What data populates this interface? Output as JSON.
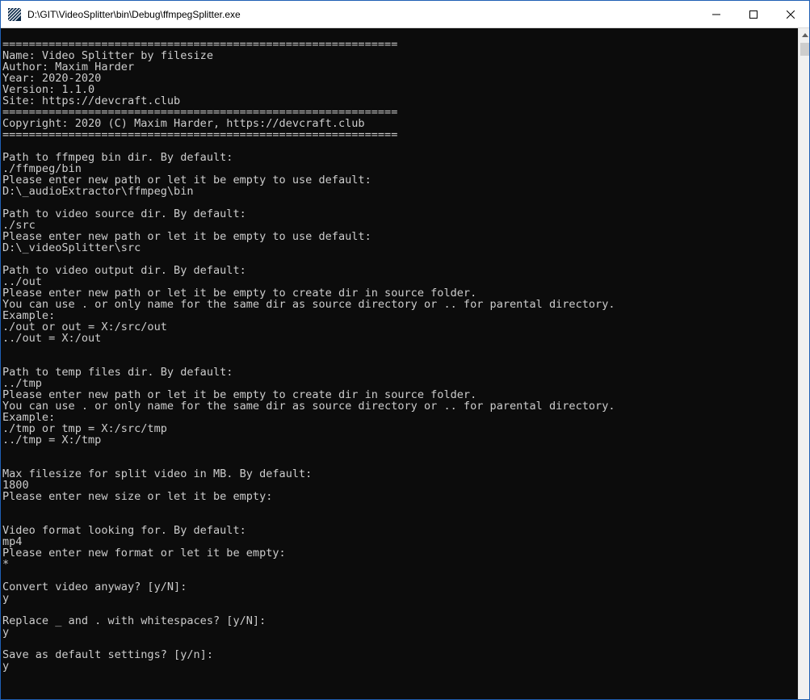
{
  "window": {
    "title": "D:\\GIT\\VideoSplitter\\bin\\Debug\\ffmpegSplitter.exe"
  },
  "controls": {
    "minimize": "minimize-icon",
    "maximize": "maximize-icon",
    "close": "close-icon"
  },
  "console": {
    "lines": [
      "============================================================",
      "Name: Video Splitter by filesize",
      "Author: Maxim Harder",
      "Year: 2020-2020",
      "Version: 1.1.0",
      "Site: https://devcraft.club",
      "============================================================",
      "Copyright: 2020 (C) Maxim Harder, https://devcraft.club",
      "============================================================",
      "",
      "Path to ffmpeg bin dir. By default:",
      "./ffmpeg/bin",
      "Please enter new path or let it be empty to use default:",
      "D:\\_audioExtractor\\ffmpeg\\bin",
      "",
      "Path to video source dir. By default:",
      "./src",
      "Please enter new path or let it be empty to use default:",
      "D:\\_videoSplitter\\src",
      "",
      "Path to video output dir. By default:",
      "../out",
      "Please enter new path or let it be empty to create dir in source folder.",
      "You can use . or only name for the same dir as source directory or .. for parental directory.",
      "Example:",
      "./out or out = X:/src/out",
      "../out = X:/out",
      "",
      "",
      "Path to temp files dir. By default:",
      "../tmp",
      "Please enter new path or let it be empty to create dir in source folder.",
      "You can use . or only name for the same dir as source directory or .. for parental directory.",
      "Example:",
      "./tmp or tmp = X:/src/tmp",
      "../tmp = X:/tmp",
      "",
      "",
      "Max filesize for split video in MB. By default:",
      "1800",
      "Please enter new size or let it be empty:",
      "",
      "",
      "Video format looking for. By default:",
      "mp4",
      "Please enter new format or let it be empty:",
      "*",
      "",
      "Convert video anyway? [y/N]:",
      "y",
      "",
      "Replace _ and . with whitespaces? [y/N]:",
      "y",
      "",
      "Save as default settings? [y/n]:",
      "y"
    ]
  }
}
